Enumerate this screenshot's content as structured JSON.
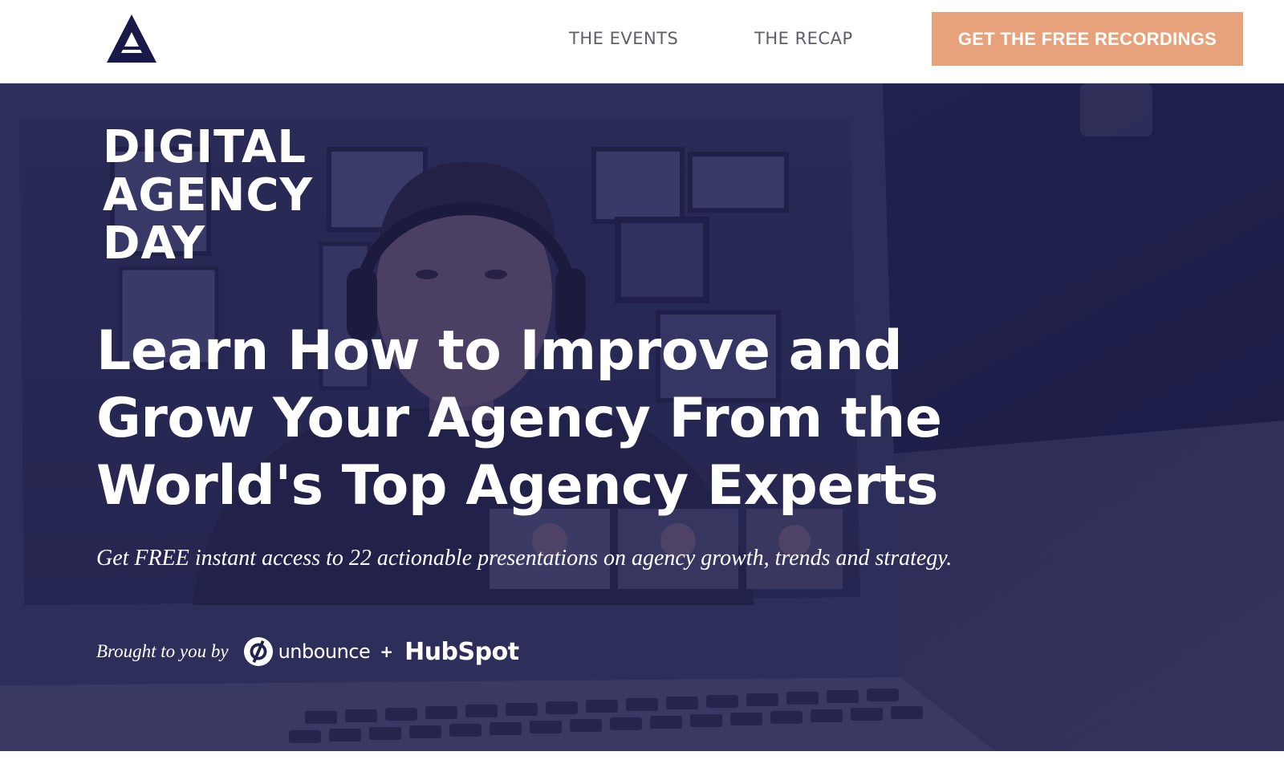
{
  "header": {
    "nav": {
      "events_label": "THE EVENTS",
      "recap_label": "THE RECAP"
    },
    "cta_label": "GET THE FREE RECORDINGS"
  },
  "hero": {
    "event_logo": {
      "line1": "DIGITAL",
      "line2": "AGENCY",
      "line3": "DAY"
    },
    "headline": "Learn How to Improve and Grow Your Agency From the World's Top Agency Experts",
    "subheadline": "Get FREE instant access to 22 actionable presentations on agency growth, trends and strategy.",
    "sponsors": {
      "intro": "Brought to you by",
      "partner1": "unbounce",
      "separator": "+",
      "partner2": "HubSpot"
    }
  },
  "colors": {
    "navy": "#1a1a4a",
    "cta_orange": "#e8a27b",
    "nav_text": "#5e5e6a",
    "hero_overlay": "#22224e"
  },
  "icons": {
    "brand": "a-triangle-logo-icon",
    "unbounce": "unbounce-logo-icon"
  }
}
